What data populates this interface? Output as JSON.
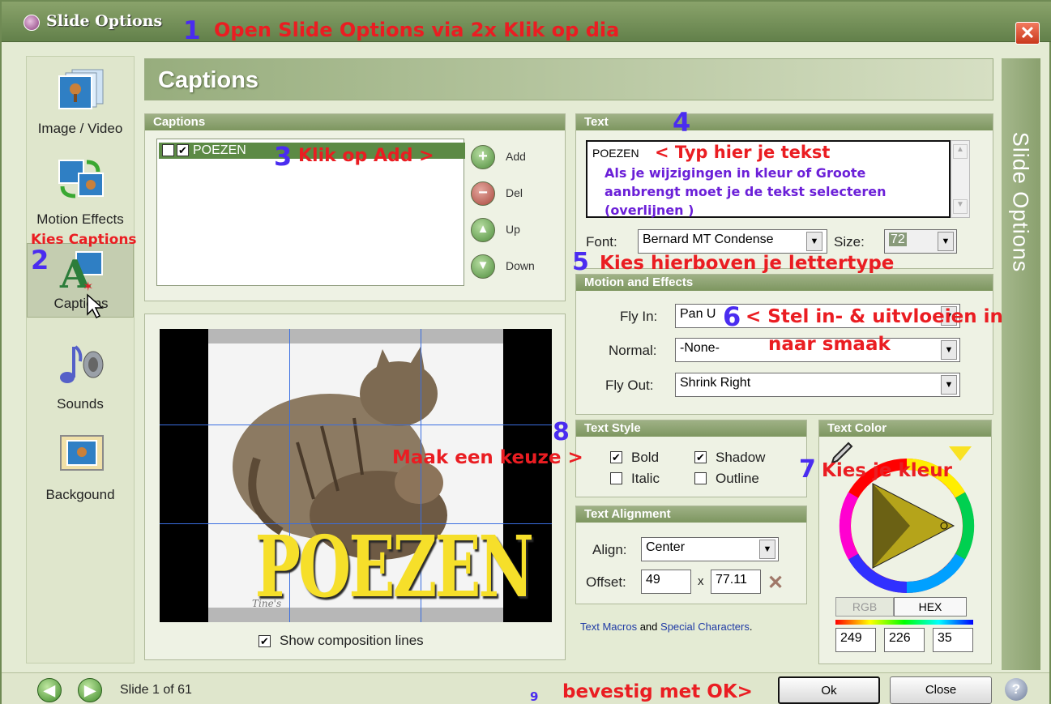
{
  "window": {
    "title": "Slide Options",
    "close_glyph": "✕"
  },
  "annotations": {
    "n1": "1",
    "t1": "Open Slide Options via 2x Klik op dia",
    "n2": "2",
    "t2": "Kies Captions",
    "n3": "3",
    "t3": "Klik op Add >",
    "n4": "4",
    "t4a": "< Typ hier je tekst",
    "t4b": "Als je wijzigingen in kleur of Groote aanbrengt moet je de tekst selecteren (overlijnen )",
    "n5": "5",
    "t5": "Kies hierboven je lettertype",
    "n6": "6",
    "t6a": "< Stel in- & uitvloeien in",
    "t6b": "naar smaak",
    "n7": "7",
    "t7": "Kies je kleur",
    "n8": "8",
    "t8": "Maak een keuze >",
    "n9": "9",
    "t9": "bevestig met OK>"
  },
  "nav": {
    "items": [
      {
        "label": "Image / Video",
        "icon": "image-video-icon"
      },
      {
        "label": "Motion Effects",
        "icon": "motion-effects-icon"
      },
      {
        "label": "Captions",
        "icon": "captions-icon",
        "selected": true
      },
      {
        "label": "Sounds",
        "icon": "sounds-icon"
      },
      {
        "label": "Backgound",
        "icon": "background-icon"
      }
    ]
  },
  "header": {
    "title": "Captions"
  },
  "sidebar": {
    "title": "Slide Options"
  },
  "captions": {
    "title": "Captions",
    "items": [
      {
        "label": "POEZEN",
        "checked": true
      }
    ],
    "buttons": {
      "add": "Add",
      "del": "Del",
      "up": "Up",
      "down": "Down"
    }
  },
  "preview": {
    "caption_text": "POEZEN",
    "watermark": "Tine's",
    "show_lines_label": "Show composition lines",
    "show_lines_checked": true
  },
  "text": {
    "title": "Text",
    "value": "POEZEN",
    "font_label": "Font:",
    "font_value": "Bernard MT Condense",
    "size_label": "Size:",
    "size_value": "72"
  },
  "motion": {
    "title": "Motion and Effects",
    "fly_in_label": "Fly In:",
    "fly_in_value": "Pan U",
    "normal_label": "Normal:",
    "normal_value": "-None-",
    "fly_out_label": "Fly Out:",
    "fly_out_value": "Shrink Right"
  },
  "text_style": {
    "title": "Text Style",
    "bold": "Bold",
    "italic": "Italic",
    "shadow": "Shadow",
    "outline": "Outline",
    "bold_checked": true,
    "shadow_checked": true
  },
  "alignment": {
    "title": "Text Alignment",
    "align_label": "Align:",
    "align_value": "Center",
    "offset_label": "Offset:",
    "offset_x": "49",
    "offset_sep": "x",
    "offset_y": "77.11"
  },
  "macros": {
    "link1": "Text Macros",
    "and": "and",
    "link2": "Special Characters",
    "dot": "."
  },
  "color": {
    "title": "Text Color",
    "rgb_tab": "RGB",
    "hex_tab": "HEX",
    "r": "249",
    "g": "226",
    "b": "35",
    "swatch": "#f9e223"
  },
  "footer": {
    "slide_text": "Slide 1 of 61",
    "ok": "Ok",
    "close": "Close",
    "help": "?"
  }
}
